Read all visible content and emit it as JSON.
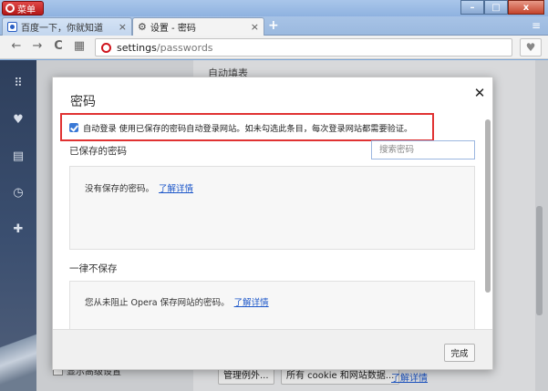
{
  "window": {
    "menu_label": "菜单",
    "minimize": "–",
    "maximize": "□",
    "close": "x"
  },
  "tabs": [
    {
      "title": "百度一下，你就知道",
      "close": "×"
    },
    {
      "title": "设置 - 密码",
      "close": "×"
    }
  ],
  "new_tab": "+",
  "tab_menu": "≡",
  "address": {
    "host": "settings",
    "path": "/passwords"
  },
  "page": {
    "heading": "自动填表",
    "check_label": "显示高级设置",
    "buttons": [
      "管理例外...",
      "所有 cookie 和网站数据..."
    ],
    "link": "了解详情"
  },
  "dialog": {
    "title": "密码",
    "close": "✕",
    "auto_signin_label": "自动登录 使用已保存的密码自动登录网站。如未勾选此条目，每次登录网站都需要验证。",
    "auto_signin_checked": true,
    "saved_heading": "已保存的密码",
    "search_placeholder": "搜索密码",
    "saved_empty_text": "没有保存的密码。",
    "never_heading": "一律不保存",
    "never_empty_text": "您从未阻止 Opera 保存网站的密码。",
    "learn_more": "了解详情",
    "done_label": "完成"
  },
  "colors": {
    "accent": "#3a79d6",
    "link": "#1d57c9",
    "highlight": "#e03232",
    "opera_red": "#d0161e"
  },
  "icons": {
    "sidebar": [
      "speed-dial-icon",
      "heart-icon",
      "news-icon",
      "history-icon",
      "extensions-icon"
    ]
  }
}
